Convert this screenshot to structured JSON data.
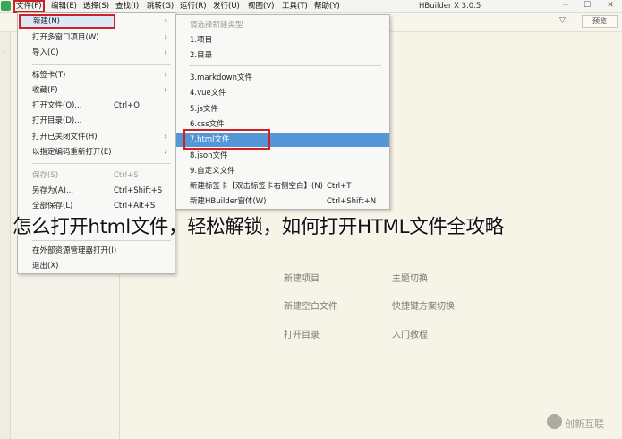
{
  "window": {
    "title": "HBuilder X 3.0.5",
    "menu": [
      "文件(F)",
      "编辑(E)",
      "选择(S)",
      "查找(I)",
      "跳转(G)",
      "运行(R)",
      "发行(U)",
      "视图(V)",
      "工具(T)",
      "帮助(Y)"
    ],
    "controls": [
      "─",
      "☐",
      "✕"
    ]
  },
  "toolbar": {
    "filter_icon": "funnel-icon",
    "preview_label": "预览"
  },
  "file_menu": {
    "items": [
      {
        "label": "新建(N)",
        "shortcut": "",
        "submenu": true
      },
      {
        "label": "打开多窗口项目(W)",
        "shortcut": "",
        "submenu": true
      },
      {
        "label": "导入(C)",
        "shortcut": "",
        "submenu": true
      },
      {
        "label": "标签卡(T)",
        "shortcut": "",
        "submenu": true
      },
      {
        "label": "收藏(F)",
        "shortcut": "",
        "submenu": true
      },
      {
        "label": "打开文件(O)...",
        "shortcut": "Ctrl+O",
        "submenu": false
      },
      {
        "label": "打开目录(D)...",
        "shortcut": "",
        "submenu": false
      },
      {
        "label": "打开已关闭文件(H)",
        "shortcut": "",
        "submenu": true
      },
      {
        "label": "以指定编码重新打开(E)",
        "shortcut": "",
        "submenu": true
      },
      {
        "label": "保存(S)",
        "shortcut": "Ctrl+S",
        "submenu": false
      },
      {
        "label": "另存为(A)...",
        "shortcut": "Ctrl+Shift+S",
        "submenu": false
      },
      {
        "label": "全部保存(L)",
        "shortcut": "Ctrl+Alt+S",
        "submenu": false
      },
      {
        "label": "在外部资源管理器打开(I)",
        "shortcut": "",
        "submenu": false
      },
      {
        "label": "退出(X)",
        "shortcut": "",
        "submenu": false
      }
    ]
  },
  "new_menu": {
    "header": "请选择新建类型",
    "items": [
      {
        "label": "1.项目",
        "shortcut": ""
      },
      {
        "label": "2.目录",
        "shortcut": ""
      },
      {
        "label": "3.markdown文件",
        "shortcut": ""
      },
      {
        "label": "4.vue文件",
        "shortcut": ""
      },
      {
        "label": "5.js文件",
        "shortcut": ""
      },
      {
        "label": "6.css文件",
        "shortcut": ""
      },
      {
        "label": "7.html文件",
        "shortcut": ""
      },
      {
        "label": "8.json文件",
        "shortcut": ""
      },
      {
        "label": "9.自定义文件",
        "shortcut": ""
      },
      {
        "label": "新建标签卡【双击标签卡右侧空白】(N)",
        "shortcut": "Ctrl+T"
      },
      {
        "label": "新建HBuilder窗体(W)",
        "shortcut": "Ctrl+Shift+N"
      }
    ]
  },
  "welcome": {
    "links": [
      "新建项目",
      "主题切换",
      "新建空白文件",
      "快捷键方案切换",
      "打开目录",
      "入门教程"
    ]
  },
  "overlay_caption": "怎么打开html文件，轻松解锁，如何打开HTML文件全攻略",
  "watermark": {
    "text": "创新互联"
  }
}
